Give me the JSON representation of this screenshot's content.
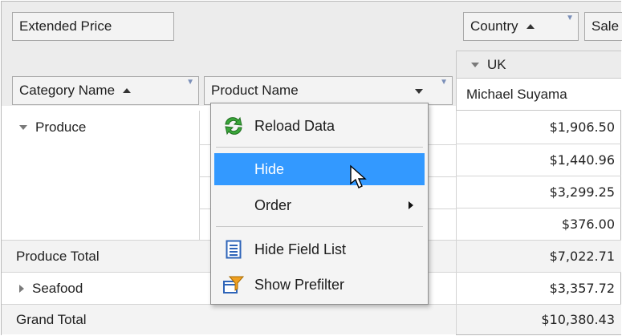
{
  "pivot": {
    "data_header": "Extended Price",
    "column_fields": [
      {
        "label": "Country",
        "sorted": "ascending"
      },
      {
        "label": "Sale"
      }
    ],
    "row_fields": [
      {
        "label": "Category Name",
        "sorted": "ascending"
      },
      {
        "label": "Product Name"
      }
    ],
    "column_groups": [
      {
        "label": "UK",
        "expanded": true
      }
    ],
    "column_values": [
      "Michael Suyama"
    ],
    "rows": [
      {
        "label": "Produce",
        "expanded": true,
        "values": [
          "$1,906.50",
          "$1,440.96",
          "$3,299.25",
          "$376.00"
        ]
      },
      {
        "label": "Produce Total",
        "total": true,
        "value": "$7,022.71"
      },
      {
        "label": "Seafood",
        "expanded": false,
        "value": "$3,357.72"
      },
      {
        "label": "Grand Total",
        "total": true,
        "value": "$10,380.43"
      }
    ]
  },
  "context_menu": {
    "items": [
      {
        "label": "Reload Data",
        "icon": "reload-icon"
      },
      {
        "label": "Hide",
        "highlighted": true
      },
      {
        "label": "Order",
        "submenu": true
      },
      {
        "label": "Hide Field List",
        "icon": "field-list-icon"
      },
      {
        "label": "Show Prefilter",
        "icon": "prefilter-icon"
      }
    ]
  },
  "colors": {
    "highlight": "#3399ff",
    "header_bg": "#ececec",
    "field_bg": "#f3f3f3"
  }
}
